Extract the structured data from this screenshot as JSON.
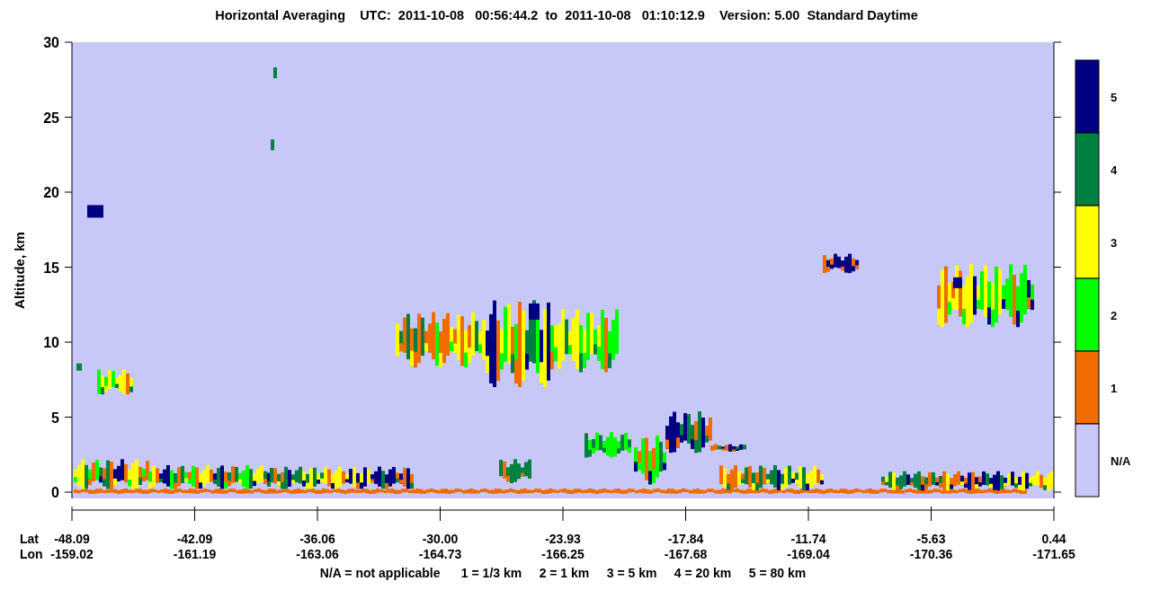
{
  "title": "Horizontal Averaging    UTC:  2011-10-08   00:56:44.2  to  2011-10-08   01:10:12.9    Version: 5.00  Standard Daytime",
  "y_axis": {
    "label": "Altitude, km",
    "ticks": [
      "30",
      "25",
      "20",
      "15",
      "10",
      "5",
      "0"
    ]
  },
  "x_axis": {
    "lat_label": "Lat",
    "lon_label": "Lon",
    "lat_ticks": [
      "-48.09",
      "-42.09",
      "-36.06",
      "-30.00",
      "-23.93",
      "-17.84",
      "-11.74",
      "-5.63",
      "0.44"
    ],
    "lon_ticks": [
      "-159.02",
      "-161.19",
      "-163.06",
      "-164.73",
      "-166.25",
      "-167.68",
      "-169.04",
      "-170.36",
      "-171.65"
    ]
  },
  "colorbar": [
    {
      "label": "5",
      "color": "#000080"
    },
    {
      "label": "4",
      "color": "#008040"
    },
    {
      "label": "3",
      "color": "#ffff00"
    },
    {
      "label": "2",
      "color": "#00ff00"
    },
    {
      "label": "1",
      "color": "#f06c00"
    },
    {
      "label": "N/A",
      "color": "#c8c8f8"
    }
  ],
  "legend": "N/A = not applicable      1 = 1/3 km     2 = 1 km     3 = 5 km     4 = 20 km     5 = 80 km"
}
